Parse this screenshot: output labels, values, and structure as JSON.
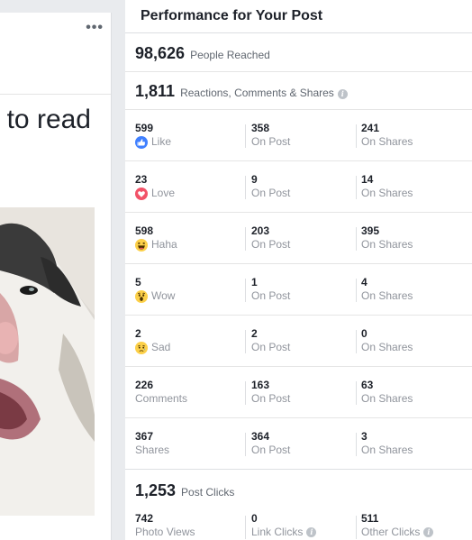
{
  "post": {
    "more_label": "•••",
    "text_fragment": "to read"
  },
  "panel": {
    "title": "Performance for Your Post",
    "reach": {
      "value": "98,626",
      "label": "People Reached"
    },
    "engagement": {
      "value": "1,811",
      "label": "Reactions, Comments & Shares"
    },
    "breakdown": [
      {
        "total": "599",
        "label": "Like",
        "icon": "like-icon",
        "on_post": "358",
        "on_shares": "241"
      },
      {
        "total": "23",
        "label": "Love",
        "icon": "love-icon",
        "on_post": "9",
        "on_shares": "14"
      },
      {
        "total": "598",
        "label": "Haha",
        "icon": "haha-icon",
        "on_post": "203",
        "on_shares": "395"
      },
      {
        "total": "5",
        "label": "Wow",
        "icon": "wow-icon",
        "on_post": "1",
        "on_shares": "4"
      },
      {
        "total": "2",
        "label": "Sad",
        "icon": "sad-icon",
        "on_post": "2",
        "on_shares": "0"
      },
      {
        "total": "226",
        "label": "Comments",
        "icon": "",
        "on_post": "163",
        "on_shares": "63"
      },
      {
        "total": "367",
        "label": "Shares",
        "icon": "",
        "on_post": "364",
        "on_shares": "3"
      }
    ],
    "on_post_label": "On Post",
    "on_shares_label": "On Shares",
    "clicks": {
      "value": "1,253",
      "label": "Post Clicks",
      "photo_views": {
        "value": "742",
        "label": "Photo Views"
      },
      "link_clicks": {
        "value": "0",
        "label": "Link Clicks"
      },
      "other_clicks": {
        "value": "511",
        "label": "Other Clicks"
      }
    }
  },
  "colors": {
    "like_blue": "#4080ff",
    "love_red": "#f25268",
    "emoji_yellow": "#fcd049",
    "muted_text": "#90949c"
  }
}
